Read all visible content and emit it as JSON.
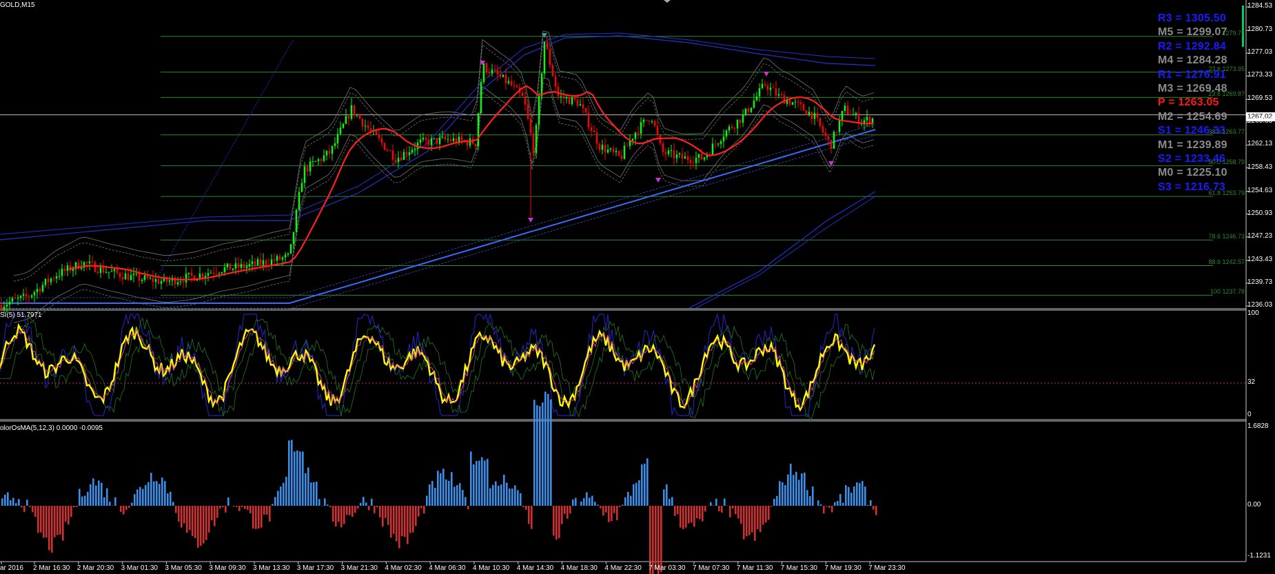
{
  "header": {
    "symbol_tf": "GOLD,M15",
    "rsi_label": "SI(5) 51.7971",
    "osma_label": "olorOsMA(5,12,3) 0.0000 -0.0095"
  },
  "current_price": "1267.02",
  "price_axis": [
    "1284.53",
    "1280.73",
    "1277.03",
    "1273.33",
    "1269.53",
    "1265.83",
    "1262.13",
    "1258.43",
    "1254.63",
    "1250.93",
    "1247.23",
    "1243.43",
    "1239.73",
    "1236.03"
  ],
  "rsi_axis": [
    "100",
    "32",
    "0"
  ],
  "osma_axis": [
    "1.6828",
    "0.00",
    "-1.1231"
  ],
  "time_axis": [
    "ar 2016",
    "2 Mar 16:30",
    "2 Mar 20:30",
    "3 Mar 01:30",
    "3 Mar 05:30",
    "3 Mar 09:30",
    "3 Mar 13:30",
    "3 Mar 17:30",
    "3 Mar 21:30",
    "4 Mar 02:30",
    "4 Mar 06:30",
    "4 Mar 10:30",
    "4 Mar 14:30",
    "4 Mar 18:30",
    "4 Mar 22:30",
    "7 Mar 03:30",
    "7 Mar 07:30",
    "7 Mar 11:30",
    "7 Mar 15:30",
    "7 Mar 19:30",
    "7 Mar 23:30"
  ],
  "pivots": [
    {
      "label": "R3 = 1305.50",
      "color": "#1a1aff"
    },
    {
      "label": "M5 = 1299.07",
      "color": "#8c8c8c"
    },
    {
      "label": "R2 = 1292.84",
      "color": "#1a1aff"
    },
    {
      "label": "M4 = 1284.28",
      "color": "#8c8c8c"
    },
    {
      "label": "R1 = 1276.91",
      "color": "#1a1aff"
    },
    {
      "label": "M3 = 1269.48",
      "color": "#8c8c8c"
    },
    {
      "label": "P   = 1263.05",
      "color": "#ff1a1a"
    },
    {
      "label": "M2 = 1254.69",
      "color": "#8c8c8c"
    },
    {
      "label": "S1 = 1246.33",
      "color": "#1a1aff"
    },
    {
      "label": "M1 = 1239.89",
      "color": "#8c8c8c"
    },
    {
      "label": "S2 = 1233.46",
      "color": "#1a1aff"
    },
    {
      "label": "M0 = 1225.10",
      "color": "#8c8c8c"
    },
    {
      "label": "S3 = 1216.73",
      "color": "#1a1aff"
    }
  ],
  "fib_levels": [
    {
      "label": "1279.75",
      "price": 1279.75
    },
    {
      "label": "23.6 1273.95",
      "price": 1273.95
    },
    {
      "label": "23.6 1269.8?",
      "price": 1269.85
    },
    {
      "label": "38.2 1263.77",
      "price": 1263.77
    },
    {
      "label": "50.0 1258.79",
      "price": 1258.79
    },
    {
      "label": "61.8 1253.79",
      "price": 1253.79
    },
    {
      "label": "78.6 1246.73",
      "price": 1246.73
    },
    {
      "label": "88.6 1242.57",
      "price": 1242.57
    },
    {
      "label": "100 1237.78",
      "price": 1237.78
    }
  ],
  "colors": {
    "bull": "#00ff00",
    "bear": "#ff0000",
    "ma_red": "#ff2020",
    "ma_blue": "#3a6bff",
    "grid_green": "#2a8a2a",
    "rsi_yellow": "#ffff00",
    "rsi_blue": "#2222aa",
    "osma_pos": "#3a8fe8",
    "osma_neg": "#d03030"
  }
}
